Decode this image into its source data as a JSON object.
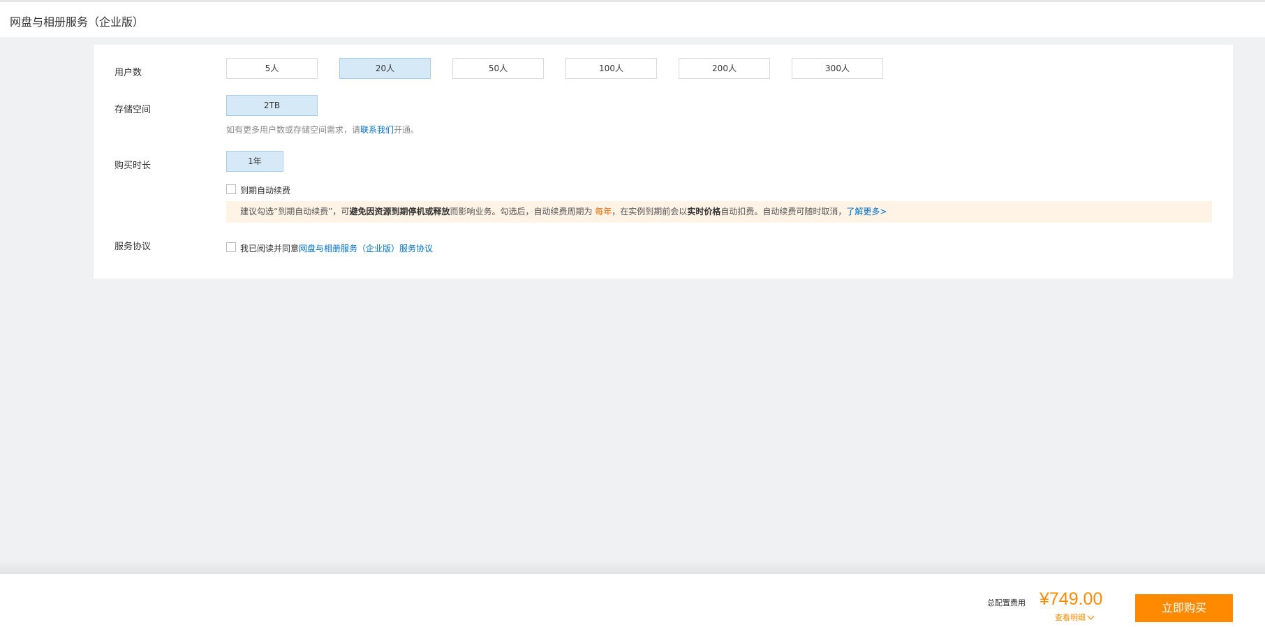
{
  "header": {
    "title": "网盘与相册服务（企业版）"
  },
  "users": {
    "label": "用户数",
    "options": [
      "5人",
      "20人",
      "50人",
      "100人",
      "200人",
      "300人"
    ],
    "selected": "20人"
  },
  "storage": {
    "label": "存储空间",
    "options": [
      "2TB"
    ],
    "selected": "2TB",
    "hint_prefix": "如有更多用户数或存储空间需求，请",
    "hint_link": "联系我们",
    "hint_suffix": "开通。"
  },
  "duration": {
    "label": "购买时长",
    "options": [
      "1年"
    ],
    "selected": "1年",
    "auto_renew_label": "到期自动续费",
    "notice": {
      "p1": "建议勾选“到期自动续费”，可",
      "b1": "避免因资源到期停机或释放",
      "p2": "而影响业务。勾选后，自动续费周期为 ",
      "accent": "每年",
      "p3": "，在实例到期前会以",
      "b2": "实时价格",
      "p4": "自动扣费。自动续费可随时取消，",
      "link": "了解更多>"
    }
  },
  "agreement": {
    "label": "服务协议",
    "text": "我已阅读并同意",
    "link": "网盘与相册服务（企业版）服务协议"
  },
  "footer": {
    "cost_label": "总配置费用",
    "price": "¥749.00",
    "detail_label": "查看明细",
    "buy_label": "立即购买"
  },
  "colors": {
    "accent": "#ff8a00",
    "link": "#0070cc",
    "selected_bg": "#d6e9f7",
    "notice_bg": "#fff3e6"
  }
}
